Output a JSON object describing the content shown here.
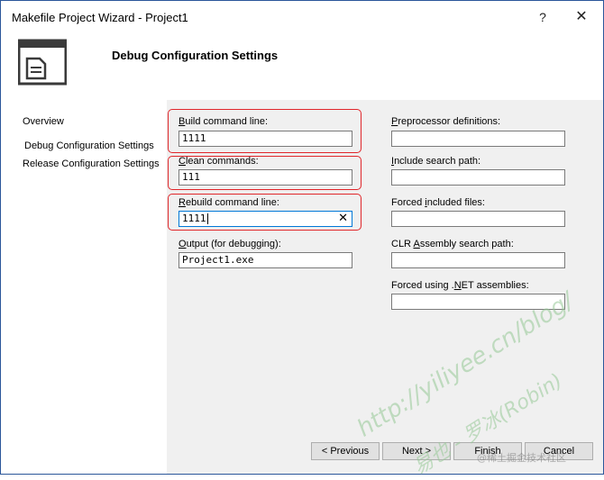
{
  "window": {
    "title": "Makefile Project Wizard - Project1",
    "help_label": "?",
    "close_label": "✕"
  },
  "header": {
    "title": "Debug Configuration Settings",
    "icon": "document-wizard-icon"
  },
  "nav": {
    "items": [
      {
        "label": "Overview"
      },
      {
        "label": "Debug Configuration Settings"
      },
      {
        "label": "Release Configuration Settings"
      }
    ]
  },
  "fields": {
    "build": {
      "accel": "B",
      "rest": "uild command line:",
      "value": "1111"
    },
    "clean": {
      "accel": "C",
      "rest": "lean commands:",
      "value": "111"
    },
    "rebuild": {
      "accel": "R",
      "rest": "ebuild command line:",
      "value": "1111"
    },
    "output": {
      "accel": "O",
      "rest": "utput (for debugging):",
      "value": "Project1.exe"
    },
    "preprocessor": {
      "accel": "P",
      "rest": "reprocessor definitions:",
      "value": ""
    },
    "include": {
      "accel": "I",
      "rest": "nclude search path:",
      "value": ""
    },
    "forced_included": {
      "pre": "Forced ",
      "accel": "i",
      "rest": "ncluded files:",
      "value": ""
    },
    "clr": {
      "pre": "CLR ",
      "accel": "A",
      "rest": "ssembly search path:",
      "value": ""
    },
    "forced_using": {
      "pre": "Forced using .",
      "accel": "N",
      "rest": "ET assemblies:",
      "value": ""
    }
  },
  "clear_glyph": "✕",
  "buttons": {
    "previous": "< Previous",
    "next": "Next >",
    "finish": "Finish",
    "cancel": "Cancel"
  },
  "watermark": {
    "line1": "http://yiliyee.cn/blog/",
    "line2": "易也 - 罗冰(Robin)",
    "line3": "@稀土掘金技术社区"
  },
  "colors": {
    "highlight": "#e0262a",
    "content_bg": "#f0f0f0",
    "focus_border": "#0078d7"
  }
}
